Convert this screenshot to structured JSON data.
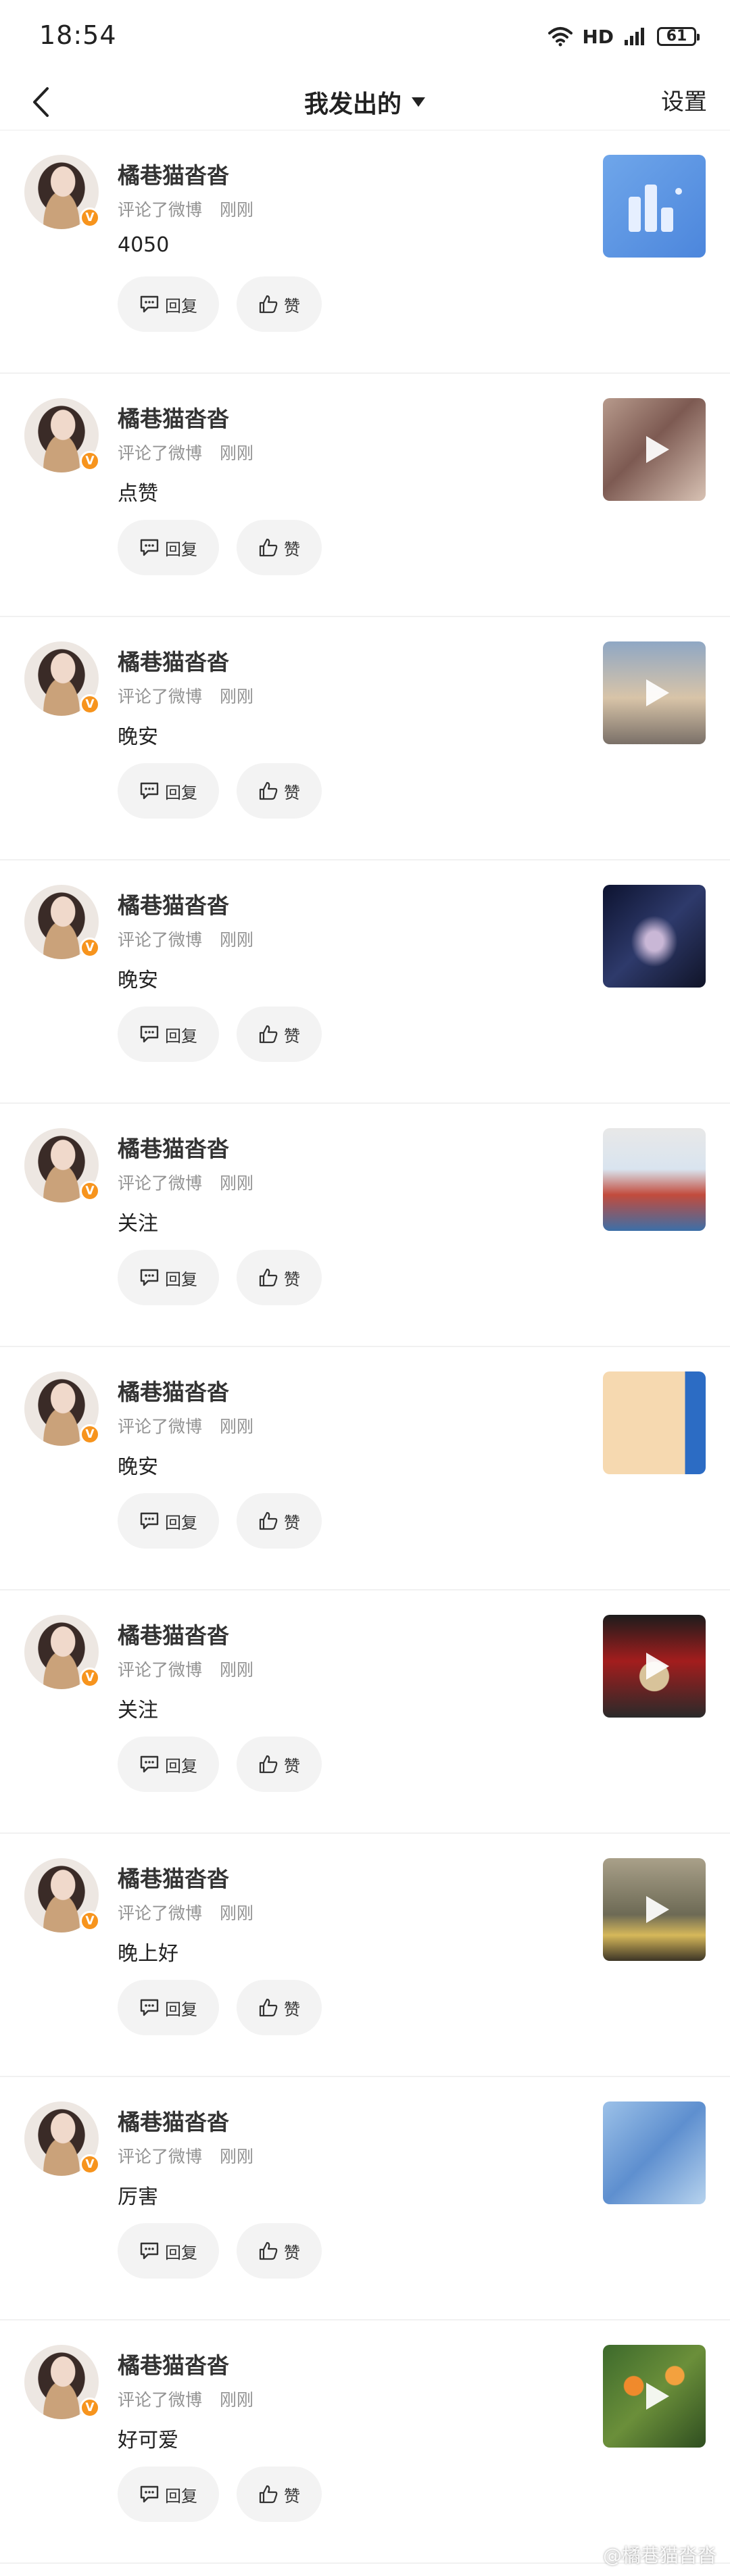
{
  "status_bar": {
    "time": "18:54",
    "network": "HD",
    "battery": "61"
  },
  "header": {
    "title": "我发出的",
    "settings_label": "设置"
  },
  "actions": {
    "reply_label": "回复",
    "like_label": "赞"
  },
  "colors": {
    "verified_badge": "#f7941d",
    "meta_text": "#939393",
    "button_bg": "#f3f3f3"
  },
  "items": [
    {
      "username": "橘巷猫沓沓",
      "action": "评论了微博",
      "time": "刚刚",
      "comment": "4050",
      "thumb": "app-icon"
    },
    {
      "username": "橘巷猫沓沓",
      "action": "评论了微博",
      "time": "刚刚",
      "comment": "点赞",
      "thumb": "video-thumbnail"
    },
    {
      "username": "橘巷猫沓沓",
      "action": "评论了微博",
      "time": "刚刚",
      "comment": "晚安",
      "thumb": "video-thumbnail"
    },
    {
      "username": "橘巷猫沓沓",
      "action": "评论了微博",
      "time": "刚刚",
      "comment": "晚安",
      "thumb": "image-thumbnail"
    },
    {
      "username": "橘巷猫沓沓",
      "action": "评论了微博",
      "time": "刚刚",
      "comment": "关注",
      "thumb": "image-thumbnail"
    },
    {
      "username": "橘巷猫沓沓",
      "action": "评论了微博",
      "time": "刚刚",
      "comment": "晚安",
      "thumb": "image-thumbnail"
    },
    {
      "username": "橘巷猫沓沓",
      "action": "评论了微博",
      "time": "刚刚",
      "comment": "关注",
      "thumb": "video-thumbnail"
    },
    {
      "username": "橘巷猫沓沓",
      "action": "评论了微博",
      "time": "刚刚",
      "comment": "晚上好",
      "thumb": "video-thumbnail"
    },
    {
      "username": "橘巷猫沓沓",
      "action": "评论了微博",
      "time": "刚刚",
      "comment": "厉害",
      "thumb": "image-thumbnail"
    },
    {
      "username": "橘巷猫沓沓",
      "action": "评论了微博",
      "time": "刚刚",
      "comment": "好可爱",
      "thumb": "video-thumbnail"
    }
  ],
  "watermark": "@橘巷猫沓沓"
}
